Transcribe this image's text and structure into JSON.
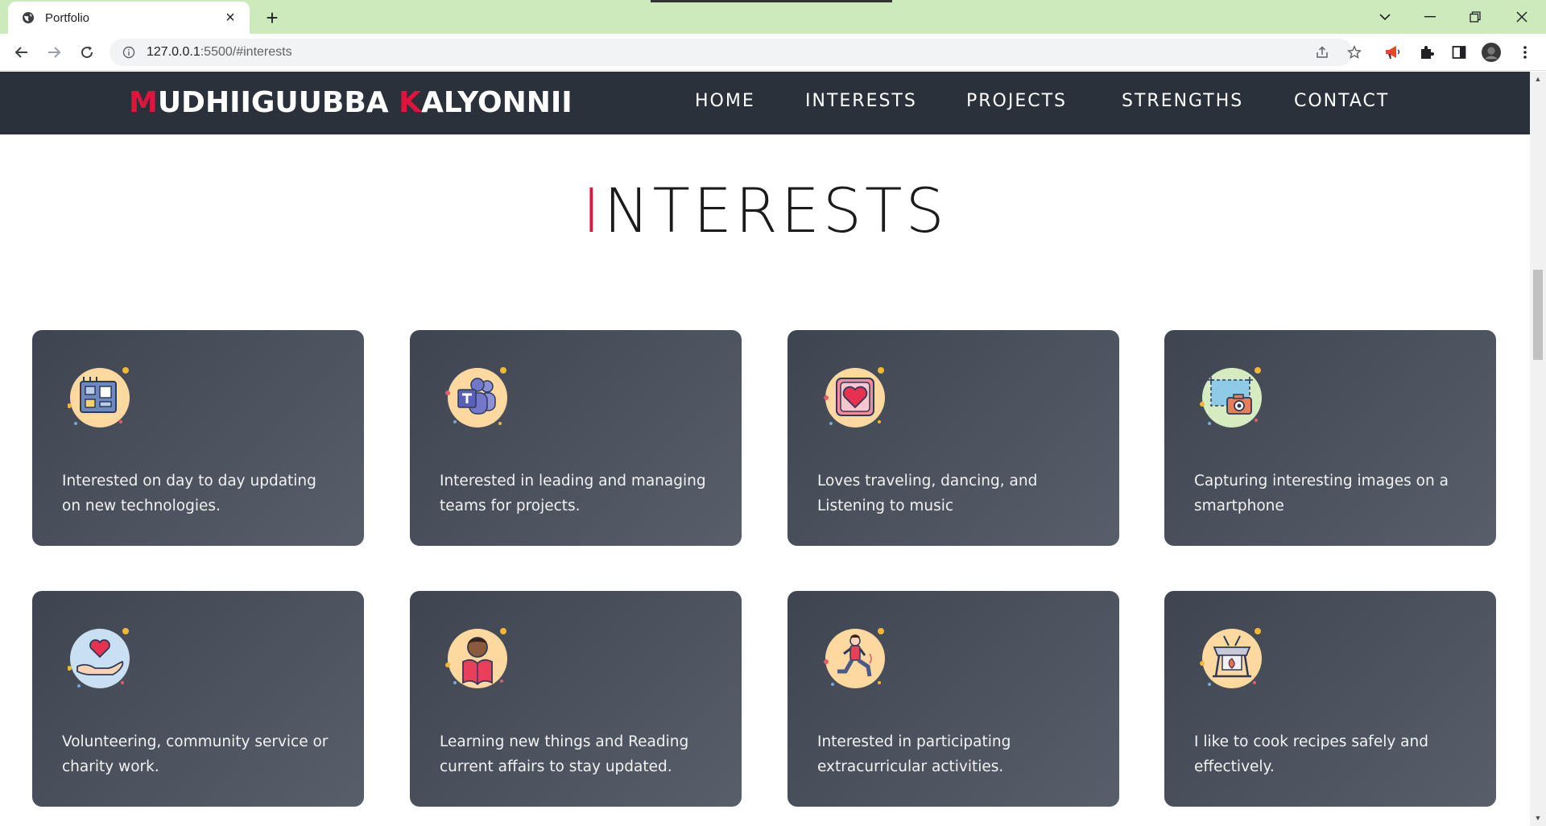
{
  "browser": {
    "tab_title": "Portfolio",
    "tab_close": "×",
    "new_tab": "+",
    "url_host": "127.0.0.1",
    "url_rest": ":5500/#interests"
  },
  "site": {
    "brand_first_initial": "M",
    "brand_first_rest": "UDHIIGUUBBA ",
    "brand_last_initial": "K",
    "brand_last_rest": "ALYONNII",
    "nav": [
      "HOME",
      "INTERESTS",
      "PROJECTS",
      "STRENGTHS",
      "CONTACT"
    ]
  },
  "section": {
    "title_initial": "I",
    "title_rest": "NTERESTS"
  },
  "cards": [
    {
      "icon": "motherboard-icon",
      "text": "Interested on day to day updating on new technologies."
    },
    {
      "icon": "teams-icon",
      "text": "Interested in leading and managing teams for projects."
    },
    {
      "icon": "heart-frame-icon",
      "text": "Loves traveling, dancing, and Listening to music"
    },
    {
      "icon": "camera-icon",
      "text": "Capturing interesting images on a smartphone"
    },
    {
      "icon": "charity-hand-icon",
      "text": "Volunteering, community service or charity work."
    },
    {
      "icon": "reading-person-icon",
      "text": "Learning new things and Reading current affairs to stay updated."
    },
    {
      "icon": "exercise-person-icon",
      "text": "Interested in participating extracurricular activities."
    },
    {
      "icon": "cooking-pot-icon",
      "text": "I like to cook recipes safely and effectively."
    }
  ],
  "colors": {
    "accent": "#e0143c",
    "nav_bg": "#2b313b",
    "card_bg": "#4b525e",
    "tabbar_bg": "#cdeabd"
  }
}
